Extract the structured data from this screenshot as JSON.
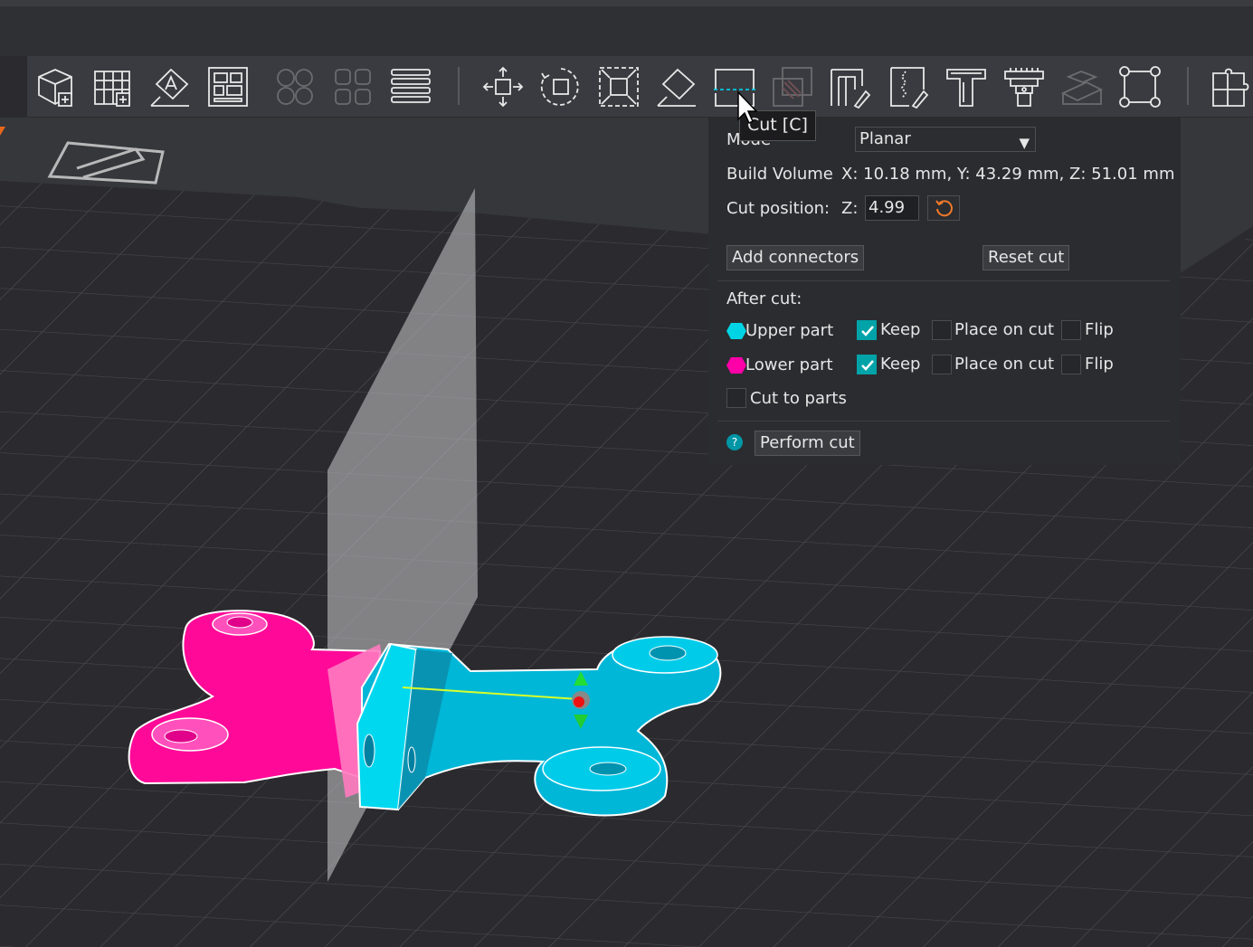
{
  "toolbar": {
    "tools": [
      {
        "name": "add-object",
        "icon": "cube-plus-icon"
      },
      {
        "name": "add-plate",
        "icon": "grid-plus-icon"
      },
      {
        "name": "orient",
        "icon": "auto-orient-icon"
      },
      {
        "name": "arrange",
        "icon": "arrange-icon"
      },
      {
        "name": "split-objects",
        "icon": "split-objects-icon"
      },
      {
        "name": "split-parts",
        "icon": "split-parts-icon"
      },
      {
        "name": "layers",
        "icon": "layers-icon"
      },
      {
        "name": "move",
        "icon": "move-icon"
      },
      {
        "name": "rotate",
        "icon": "rotate-icon"
      },
      {
        "name": "scale",
        "icon": "scale-icon"
      },
      {
        "name": "lay-on-face",
        "icon": "lay-on-face-icon"
      },
      {
        "name": "cut",
        "icon": "cut-icon"
      },
      {
        "name": "boolean",
        "icon": "boolean-icon"
      },
      {
        "name": "support-paint",
        "icon": "support-paint-icon"
      },
      {
        "name": "seam-paint",
        "icon": "seam-paint-icon"
      },
      {
        "name": "text",
        "icon": "text-icon"
      },
      {
        "name": "measure",
        "icon": "measure-icon"
      },
      {
        "name": "assembly",
        "icon": "assembly-icon"
      },
      {
        "name": "mesh-boolean",
        "icon": "mesh-boolean-icon"
      },
      {
        "name": "assemble",
        "icon": "puzzle-icon"
      }
    ]
  },
  "tooltip": "Cut [C]",
  "cut_panel": {
    "mode_label": "Mode",
    "mode_value": "Planar",
    "build_volume_label": "Build Volume",
    "build_volume_value": "X: 10.18 mm,  Y: 43.29 mm,  Z: 51.01 mm",
    "cut_position_label": "Cut position:",
    "axis_label": "Z:",
    "cut_position_value": "4.99",
    "add_connectors": "Add connectors",
    "reset_cut": "Reset cut",
    "after_cut": "After cut:",
    "upper_part": "Upper part",
    "lower_part": "Lower part",
    "keep": "Keep",
    "place_on_cut": "Place on cut",
    "flip": "Flip",
    "cut_to_parts": "Cut to parts",
    "perform_cut": "Perform cut",
    "help": "?"
  },
  "states": {
    "upper_keep": true,
    "upper_place": false,
    "upper_flip": false,
    "lower_keep": true,
    "lower_place": false,
    "lower_flip": false,
    "cut_to_parts": false
  },
  "colors": {
    "upper_part": "#00d4e4",
    "lower_part": "#ff00a8",
    "accent": "#00a3a8",
    "value_orange": "#f27a2a"
  }
}
